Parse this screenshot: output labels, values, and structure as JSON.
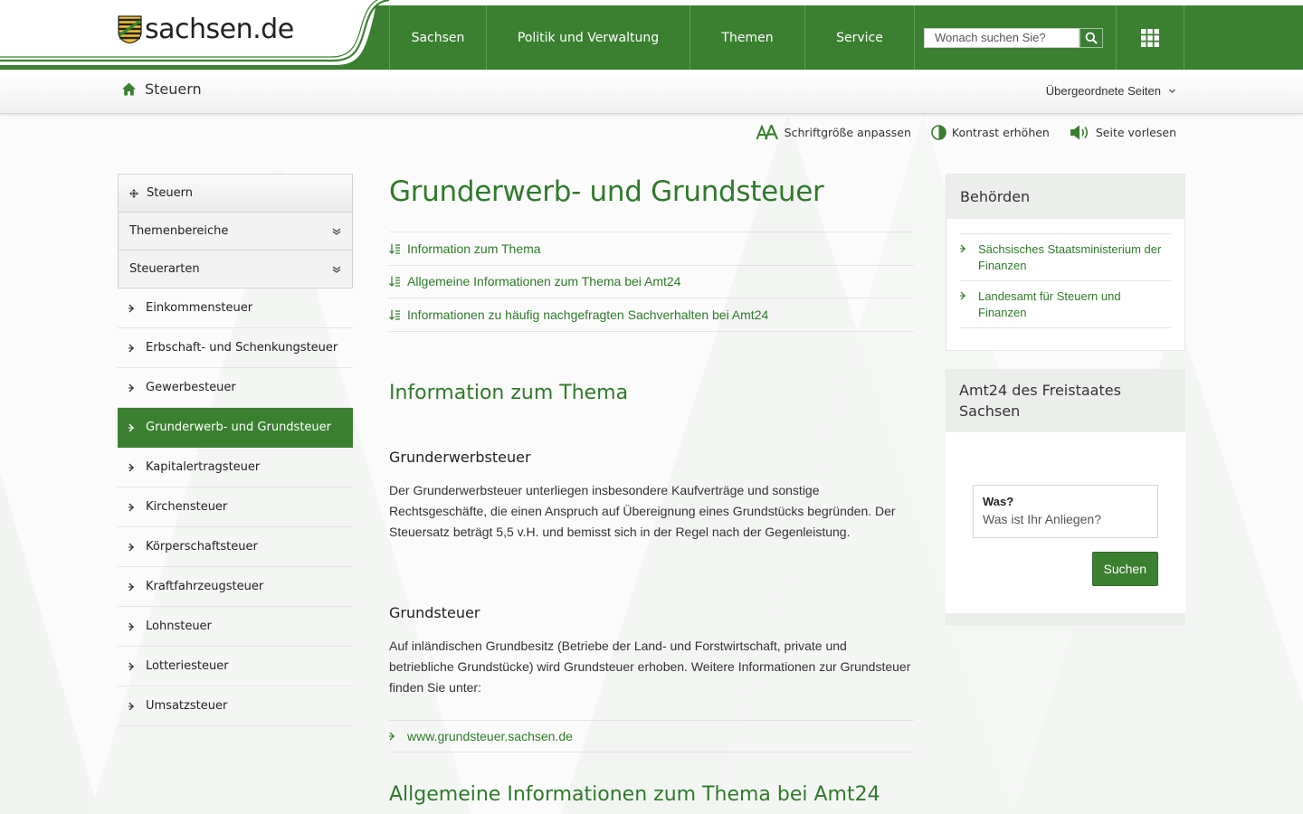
{
  "site": {
    "logo_text": "sachsen.de"
  },
  "nav": {
    "items": [
      {
        "label": "Sachsen"
      },
      {
        "label": "Politik und Verwaltung"
      },
      {
        "label": "Themen"
      },
      {
        "label": "Service"
      }
    ],
    "search_placeholder": "Wonach suchen Sie?"
  },
  "breadcrumb": {
    "current": "Steuern",
    "parent_pages_label": "Übergeordnete Seiten"
  },
  "tools": {
    "font_size": "Schriftgröße anpassen",
    "contrast": "Kontrast erhöhen",
    "read_aloud": "Seite vorlesen"
  },
  "sidebar": {
    "head": "Steuern",
    "toggles": [
      {
        "label": "Themenbereiche"
      },
      {
        "label": "Steuerarten"
      }
    ],
    "items": [
      {
        "label": "Einkommensteuer"
      },
      {
        "label": "Erbschaft- und Schenkungsteuer"
      },
      {
        "label": "Gewerbesteuer"
      },
      {
        "label": "Grunderwerb- und Grundsteuer",
        "active": true
      },
      {
        "label": "Kapitalertragsteuer"
      },
      {
        "label": "Kirchensteuer"
      },
      {
        "label": "Körperschaftsteuer"
      },
      {
        "label": "Kraftfahrzeugsteuer"
      },
      {
        "label": "Lohnsteuer"
      },
      {
        "label": "Lotteriesteuer"
      },
      {
        "label": "Umsatzsteuer"
      }
    ]
  },
  "main": {
    "title": "Grunderwerb- und Grundsteuer",
    "toc": [
      {
        "label": "Information zum Thema"
      },
      {
        "label": "Allgemeine Informationen zum Thema bei Amt24"
      },
      {
        "label": "Informationen zu häufig nachgefragten Sachverhalten bei Amt24"
      }
    ],
    "section1_title": "Information zum Thema",
    "grunderwerb_title": "Grunderwerbsteuer",
    "grunderwerb_text": "Der Grunderwerbsteuer unterliegen insbesondere Kaufverträge und sonstige Rechtsgeschäfte, die einen Anspruch auf Übereignung eines Grundstücks begründen. Der Steuersatz beträgt 5,5 v.H. und bemisst sich in der Regel nach der Gegenleistung.",
    "grundsteuer_title": "Grundsteuer",
    "grundsteuer_text": "Auf inländischen Grundbesitz (Betriebe der Land- und Forstwirtschaft, private und betriebliche Grundstücke) wird Grundsteuer erhoben. Weitere Informationen zur Grundsteuer finden Sie unter:",
    "grundsteuer_link": "www.grundsteuer.sachsen.de",
    "section2_title": "Allgemeine Informationen zum Thema bei Amt24"
  },
  "right": {
    "authorities_title": "Behörden",
    "authorities": [
      {
        "label": "Sächsisches Staatsministerium der Finanzen"
      },
      {
        "label": "Landesamt für Steuern und Finanzen"
      }
    ],
    "amt24_title": "Amt24 des Freistaates Sachsen",
    "was_label": "Was?",
    "was_placeholder": "Was ist Ihr Anliegen?",
    "search_button": "Suchen"
  },
  "colors": {
    "brand_green": "#3b8031",
    "link_green": "#2f7a2b"
  }
}
